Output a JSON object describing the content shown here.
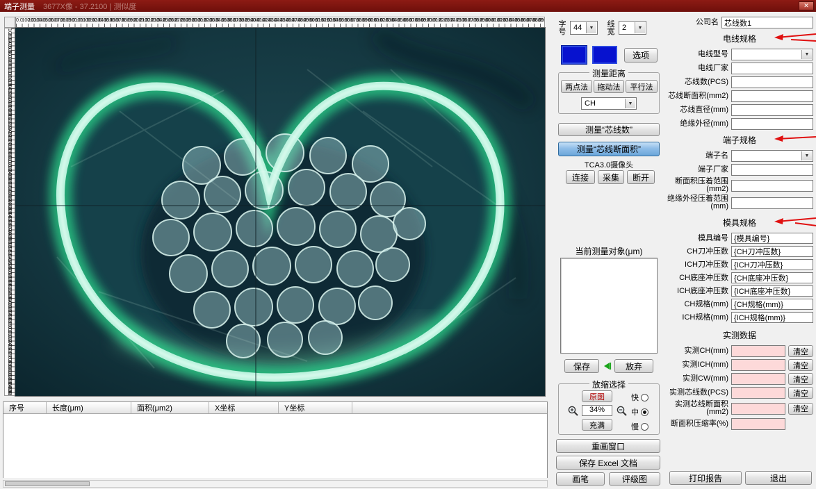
{
  "titlebar": {
    "title": "端子测量",
    "subtitle": "3677X像 - 37.2100   |   测似度",
    "close_glyph": "✕"
  },
  "rulers": {
    "horizontal": {
      "start": 0,
      "step": 100,
      "count": 90,
      "decimals": 1
    },
    "vertical": {
      "start": 100,
      "step": 100,
      "count": 86,
      "decimals": 1
    }
  },
  "results_table": {
    "columns": [
      "序号",
      "长度(μm)",
      "面积(μm2)",
      "X坐标",
      "Y坐标"
    ],
    "rows": []
  },
  "panel": {
    "font_label": "字号",
    "font_value": "44",
    "width_label": "线宽",
    "width_value": "2",
    "options": "选项",
    "measure_group": "测量距离",
    "btn_two_point": "两点法",
    "btn_drag": "拖动法",
    "btn_parallel": "平行法",
    "ch_value": "CH",
    "btn_core_count": "测量“芯线数”",
    "btn_core_area": "测量“芯线断面积”",
    "camera": "TCA3.0摄像头",
    "btn_connect": "连接",
    "btn_capture": "采集",
    "btn_disconnect": "断开",
    "current_label": "当前测量对象(μm)",
    "btn_save": "保存",
    "btn_discard": "放弃",
    "zoom_group": "放缩选择",
    "btn_original": "原图",
    "zoom_value": "34%",
    "btn_fill": "充满",
    "radio_fast": "快",
    "radio_mid": "中",
    "radio_slow": "慢",
    "btn_redraw": "重画窗口",
    "btn_excel": "保存 Excel 文档",
    "btn_pen": "画笔",
    "btn_grade": "评级图"
  },
  "right": {
    "company_label": "公司名",
    "company_value": "芯线数1",
    "wire_title": "电线规格",
    "wire_rows": [
      {
        "label": "电线型号"
      },
      {
        "label": "电线厂家"
      },
      {
        "label": "芯线数(PCS)"
      },
      {
        "label": "芯线断面积(mm2)"
      },
      {
        "label": "芯线直径(mm)"
      },
      {
        "label": "绝缘外径(mm)"
      }
    ],
    "terminal_title": "端子规格",
    "terminal_rows": [
      {
        "label": "端子名"
      },
      {
        "label": "端子厂家"
      },
      {
        "label": "断面积压着范围(mm2)"
      },
      {
        "label": "绝缘外径压着范围(mm)"
      }
    ],
    "mold_title": "模具规格",
    "mold_rows": [
      {
        "label": "模具编号",
        "value": "{模具编号}"
      },
      {
        "label": "CH刀冲压数",
        "value": "{CH刀冲压数}"
      },
      {
        "label": "ICH刀冲压数",
        "value": "{ICH刀冲压数}"
      },
      {
        "label": "CH底座冲压数",
        "value": "{CH底座冲压数}"
      },
      {
        "label": "ICH底座冲压数",
        "value": "{ICH底座冲压数}"
      },
      {
        "label": "CH规格(mm)",
        "value": "{CH规格(mm)}"
      },
      {
        "label": "ICH规格(mm)",
        "value": "{ICH规格(mm)}"
      }
    ],
    "measured_title": "实测数据",
    "measured_rows": [
      {
        "label": "实测CH(mm)",
        "clear": "清空"
      },
      {
        "label": "实测ICH(mm)",
        "clear": "清空"
      },
      {
        "label": "实测CW(mm)",
        "clear": "清空"
      },
      {
        "label": "实测芯线数(PCS)",
        "clear": "清空"
      },
      {
        "label": "实测芯线断面积(mm2)",
        "clear": "清空"
      },
      {
        "label": "断面积压缩率(%)"
      }
    ]
  },
  "footer": {
    "print": "打印报告",
    "exit": "退出"
  }
}
